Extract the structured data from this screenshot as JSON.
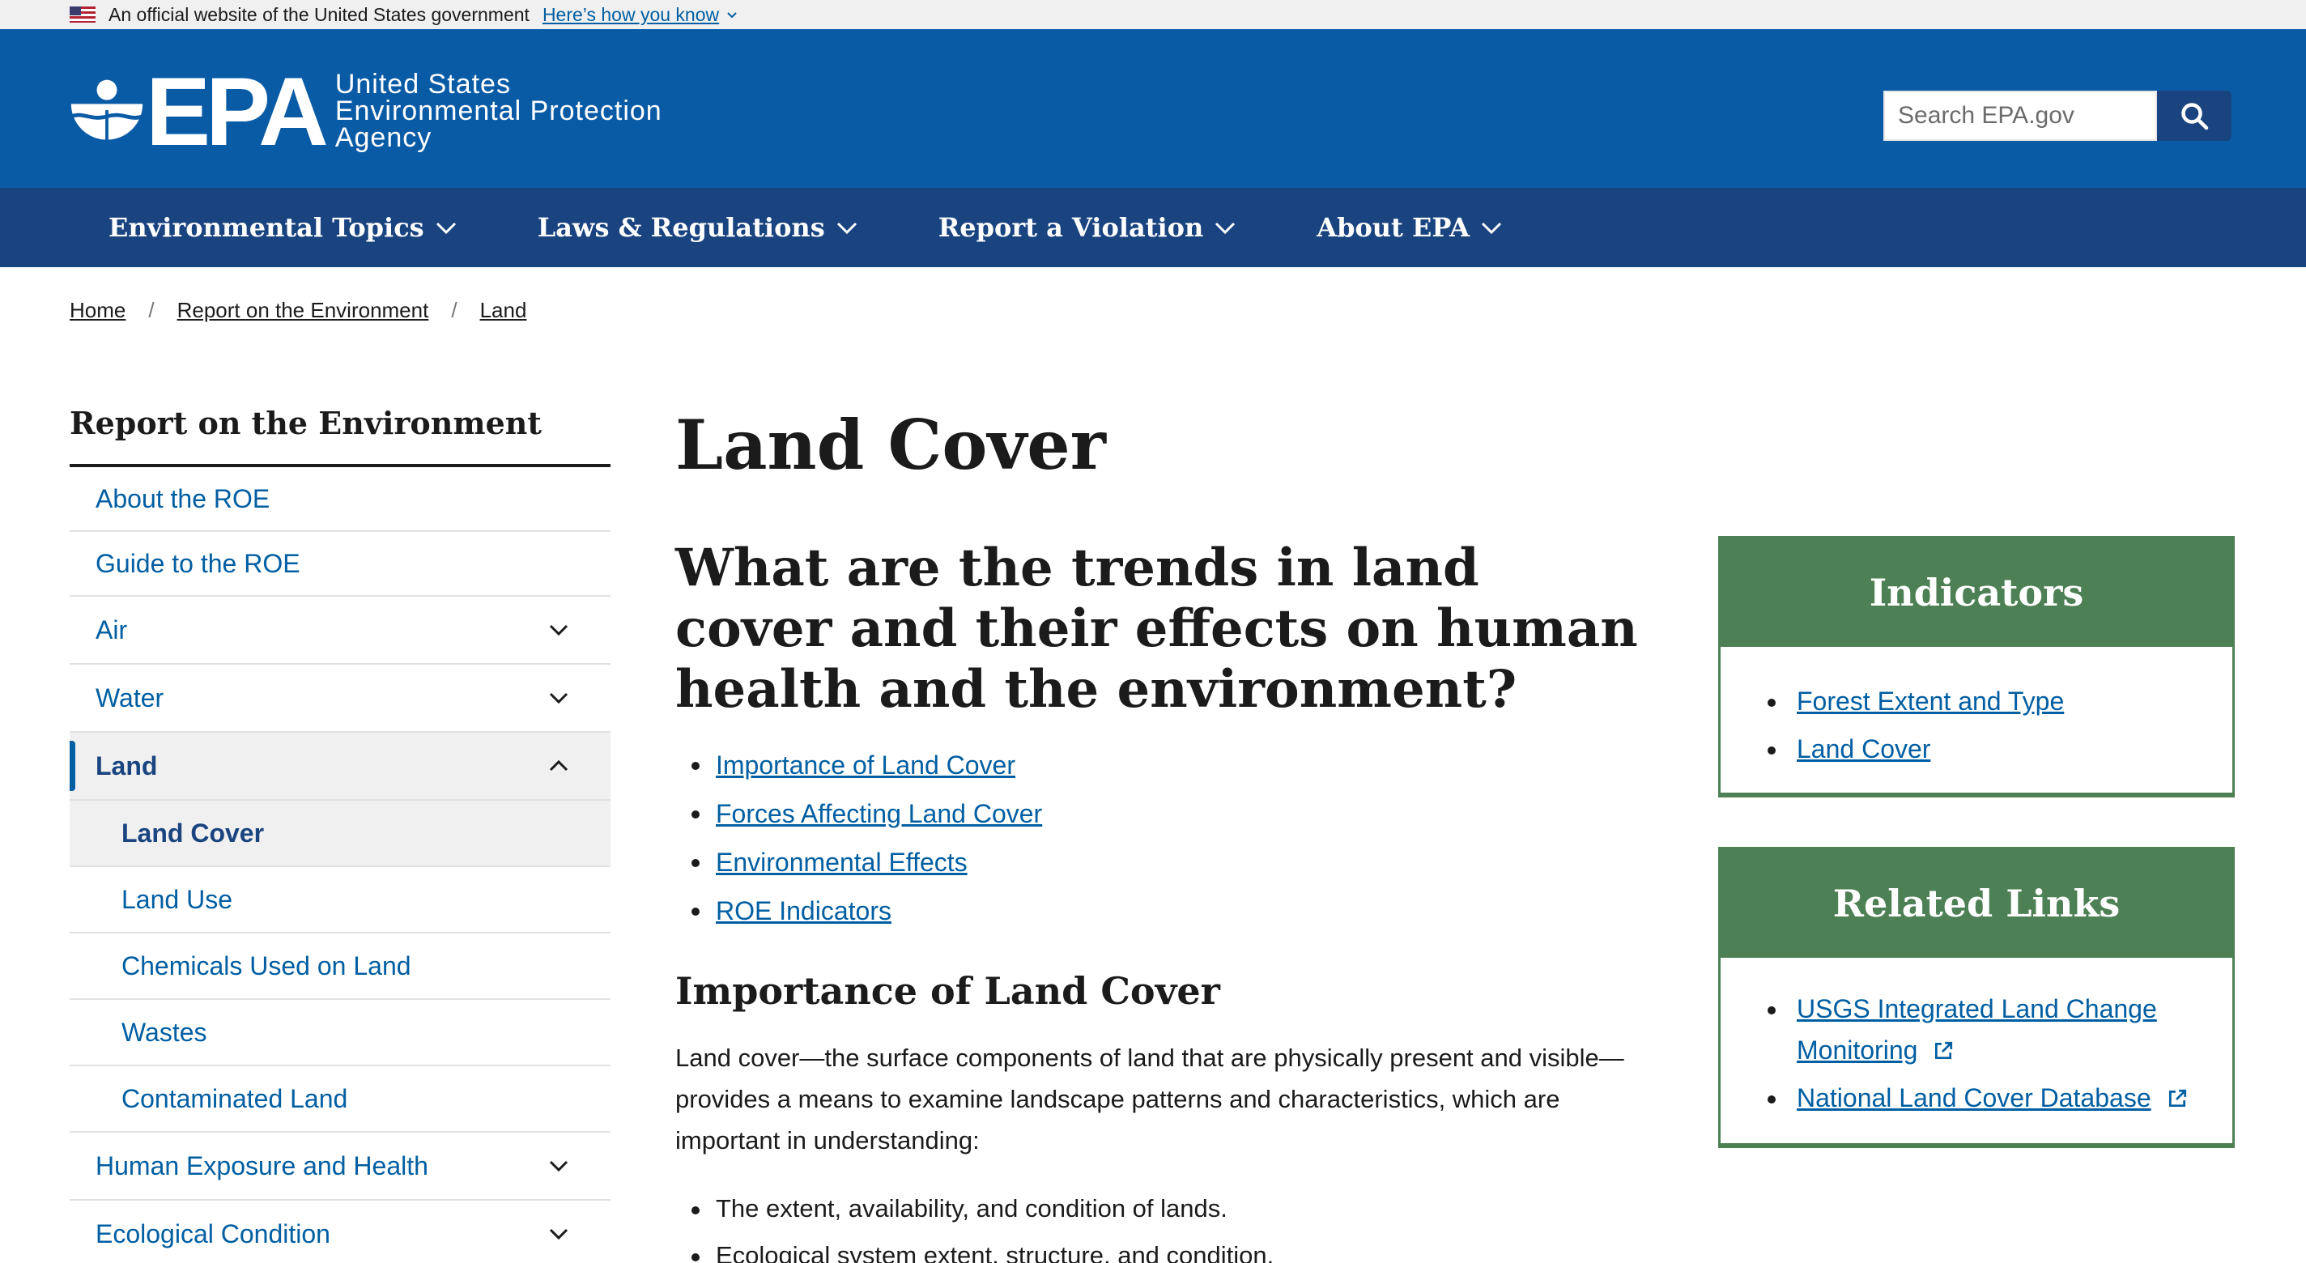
{
  "gov_banner": {
    "text": "An official website of the United States government",
    "link": "Here’s how you know"
  },
  "header": {
    "logo_letters": "EPA",
    "agency_line1": "United States",
    "agency_line2": "Environmental Protection",
    "agency_line3": "Agency",
    "search_placeholder": "Search EPA.gov",
    "brand_color": "#0a5ba6"
  },
  "nav": {
    "items": [
      {
        "label": "Environmental Topics"
      },
      {
        "label": "Laws & Regulations"
      },
      {
        "label": "Report a Violation"
      },
      {
        "label": "About EPA"
      }
    ]
  },
  "breadcrumb": {
    "items": [
      "Home",
      "Report on the Environment",
      "Land"
    ],
    "separator": "/"
  },
  "sidebar": {
    "title": "Report on the Environment",
    "items": [
      {
        "label": "About the ROE"
      },
      {
        "label": "Guide to the ROE"
      },
      {
        "label": "Air"
      },
      {
        "label": "Water"
      },
      {
        "label": "Land"
      },
      {
        "label": "Land Cover"
      },
      {
        "label": "Land Use"
      },
      {
        "label": "Chemicals Used on Land"
      },
      {
        "label": "Wastes"
      },
      {
        "label": "Contaminated Land"
      },
      {
        "label": "Human Exposure and Health"
      },
      {
        "label": "Ecological Condition"
      }
    ]
  },
  "main": {
    "title": "Land Cover",
    "question": "What are the trends in land cover and their effects on human health and the environment?",
    "toc": [
      "Importance of Land Cover",
      "Forces Affecting Land Cover",
      "Environmental Effects",
      "ROE Indicators"
    ],
    "section_heading": "Importance of Land Cover",
    "paragraph": "Land cover—the surface components of land that are physically present and visible—provides a means to examine landscape patterns and characteristics, which are important in understanding:",
    "bullets": [
      "The extent, availability, and condition of lands.",
      "Ecological system extent, structure, and condition."
    ]
  },
  "indicators_box": {
    "title": "Indicators",
    "links": [
      "Forest Extent and Type",
      "Land Cover"
    ],
    "accent_color": "#4d8055"
  },
  "related_box": {
    "title": "Related Links",
    "links": [
      "USGS Integrated Land Change Monitoring",
      "National Land Cover Database"
    ]
  }
}
